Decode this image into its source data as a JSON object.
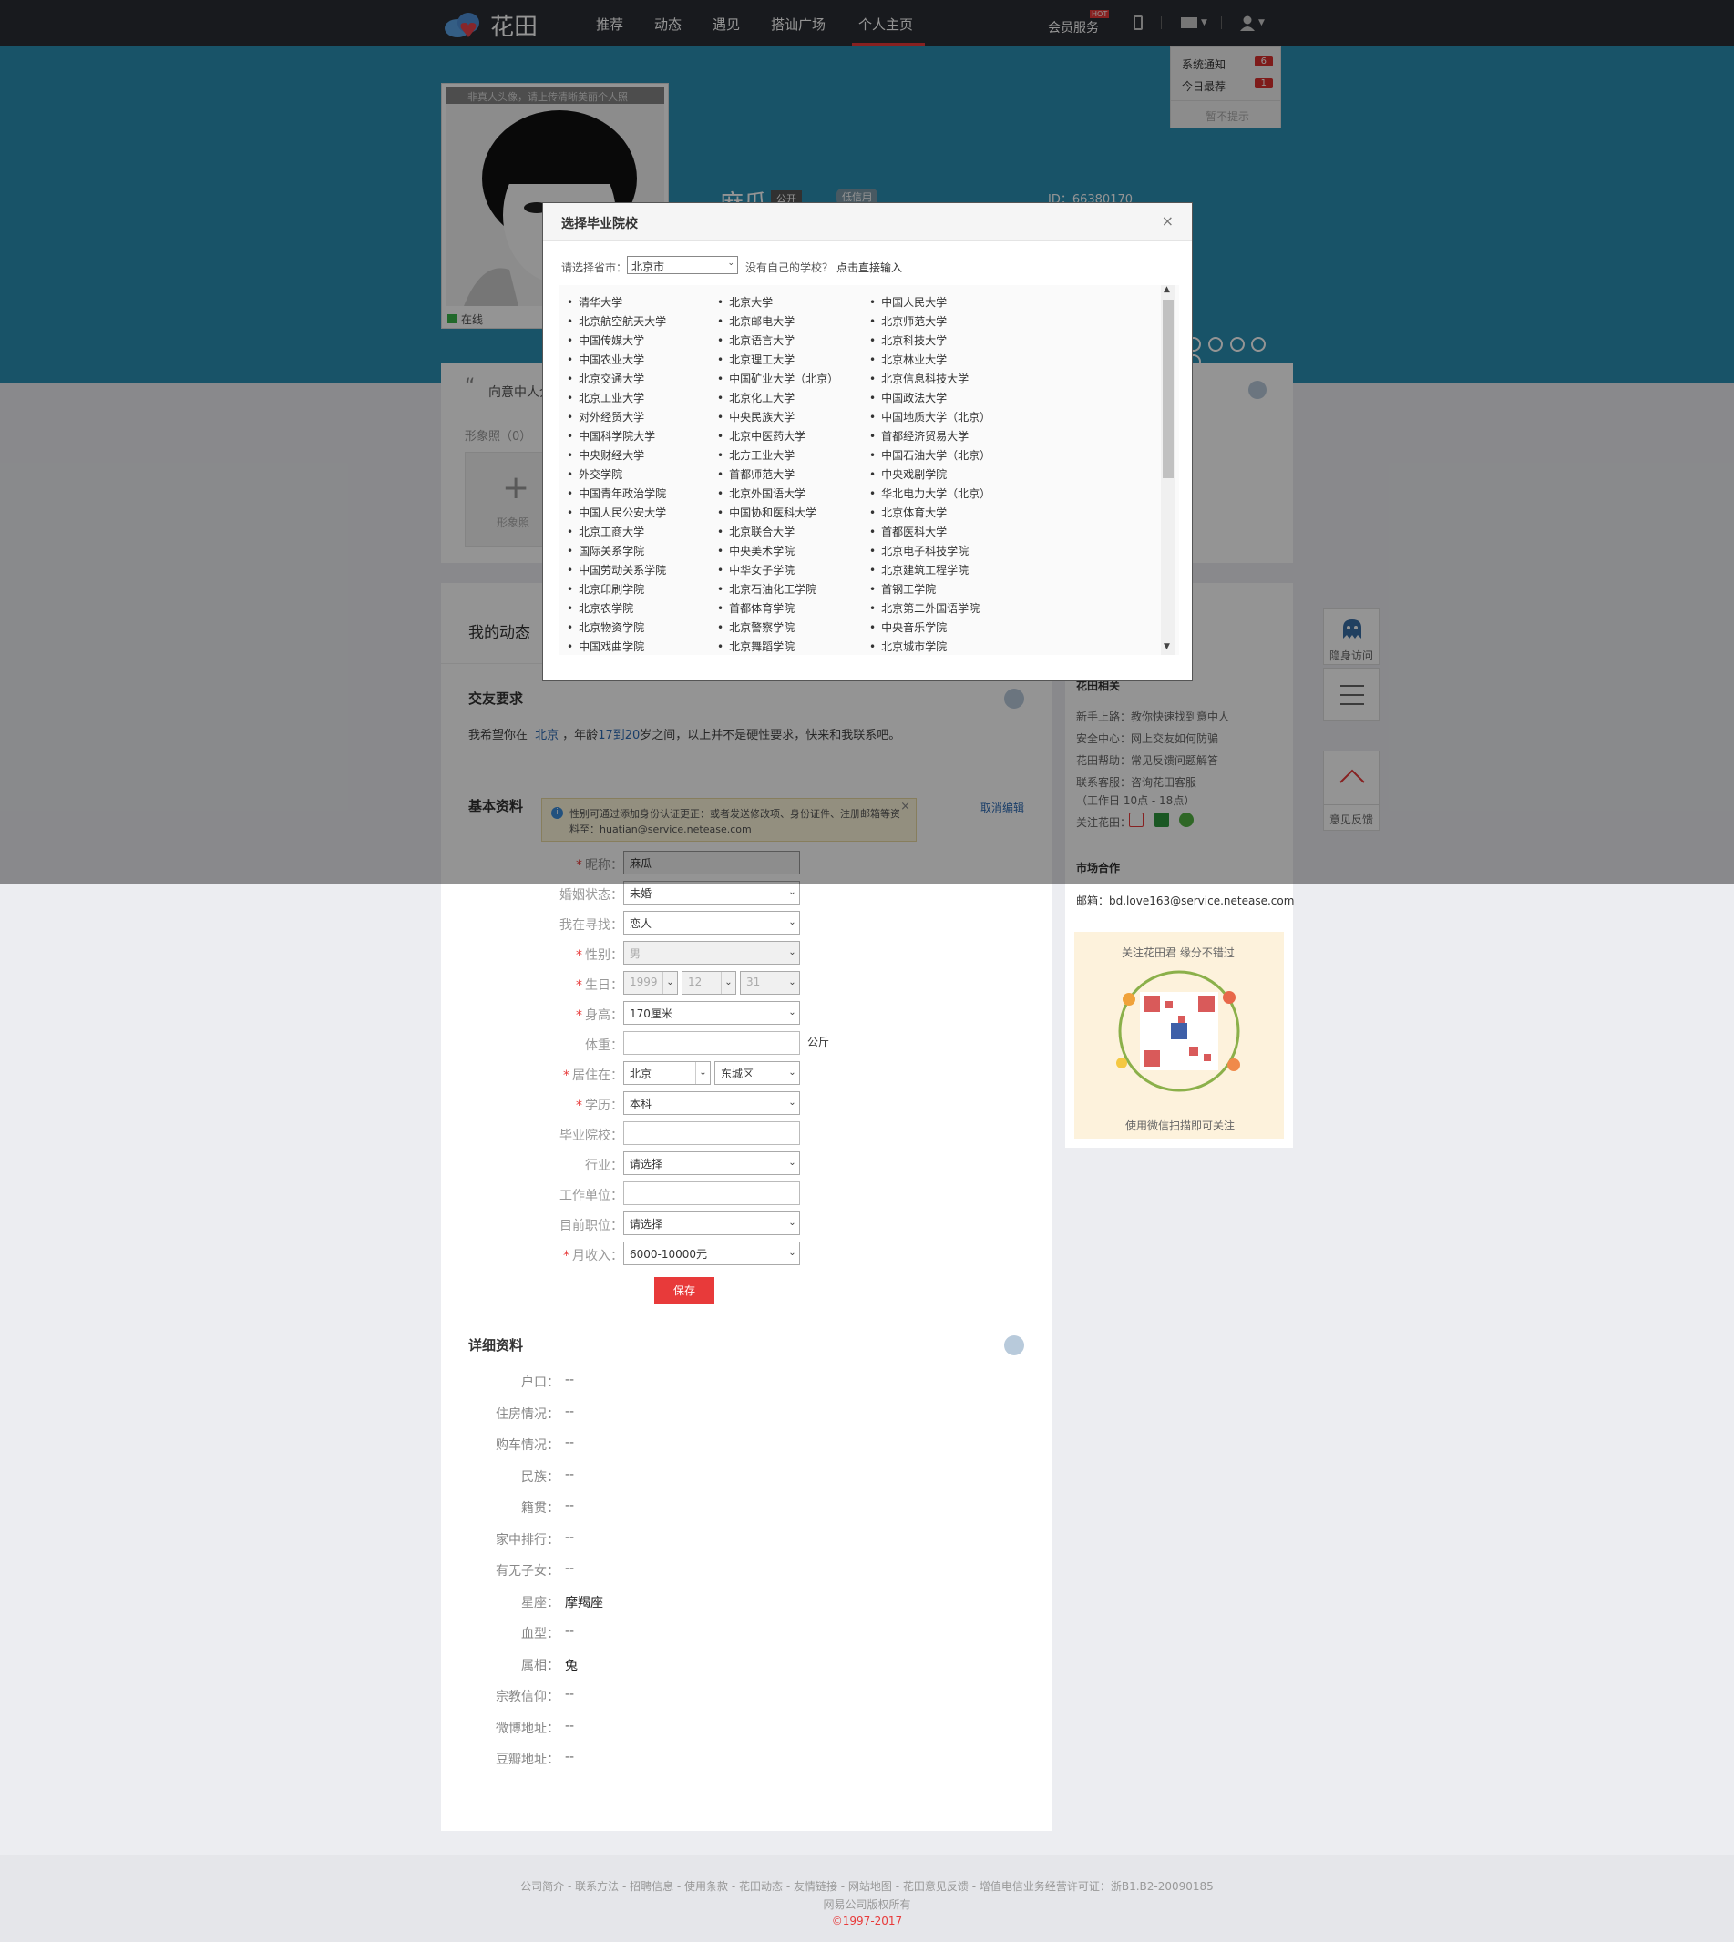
{
  "brand": {
    "name": "花田"
  },
  "nav": [
    "推荐",
    "动态",
    "遇见",
    "搭讪广场",
    "个人主页"
  ],
  "topright": {
    "vip": "会员服务",
    "hot": "HOT"
  },
  "notice": {
    "items": [
      {
        "label": "系统通知",
        "count": "6"
      },
      {
        "label": "今日最荐",
        "count": "1"
      }
    ],
    "off": "暂不提示"
  },
  "profile": {
    "avatar_tip": "非真人头像，请上传清晰美丽个人照",
    "online": "在线",
    "name": "麻瓜",
    "badge": "公开",
    "credit": "低信用",
    "id": "ID：66380170"
  },
  "intro": {
    "label": "向意中人介绍一下自己吧",
    "photos": "形象照（0）",
    "add": "形象照"
  },
  "sections": {
    "dynamic": "我的动态",
    "friend_req": "交友要求",
    "basic": "基本资料",
    "detail": "详细资料",
    "cancel_edit": "取消编辑"
  },
  "friend_text": {
    "pre": "我希望你在",
    "city": "北京",
    "mid": "，年龄",
    "a1": "17",
    "to": "到",
    "a2": "20",
    "post": "岁之间，以上并不是硬性要求，快来和我联系吧。"
  },
  "tip": "性别可通过添加身份认证更正：或者发送修改项、身份证件、注册邮箱等资料至：huatian@service.netease.com",
  "form": [
    {
      "label": "昵称：",
      "req": true,
      "type": "input",
      "value": "麻瓜"
    },
    {
      "label": "婚姻状态：",
      "req": false,
      "type": "select",
      "value": "未婚"
    },
    {
      "label": "我在寻找：",
      "req": false,
      "type": "select",
      "value": "恋人"
    },
    {
      "label": "性别：",
      "req": true,
      "type": "select-dis",
      "value": "男"
    },
    {
      "label": "生日：",
      "req": true,
      "type": "date",
      "year": "1999",
      "month": "12",
      "day": "31"
    },
    {
      "label": "身高：",
      "req": true,
      "type": "select",
      "value": "170厘米"
    },
    {
      "label": "体重：",
      "req": false,
      "type": "input-unit",
      "value": "",
      "unit": "公斤"
    },
    {
      "label": "居住在：",
      "req": true,
      "type": "city",
      "city": "北京",
      "district": "东城区"
    },
    {
      "label": "学历：",
      "req": true,
      "type": "select",
      "value": "本科"
    },
    {
      "label": "毕业院校：",
      "req": false,
      "type": "input",
      "value": ""
    },
    {
      "label": "行业：",
      "req": false,
      "type": "select",
      "value": "请选择"
    },
    {
      "label": "工作单位：",
      "req": false,
      "type": "input",
      "value": ""
    },
    {
      "label": "目前职位：",
      "req": false,
      "type": "select",
      "value": "请选择"
    },
    {
      "label": "月收入：",
      "req": true,
      "type": "select",
      "value": "6000-10000元"
    }
  ],
  "save": "保存",
  "details": [
    {
      "label": "户口：",
      "value": "--"
    },
    {
      "label": "住房情况：",
      "value": "--"
    },
    {
      "label": "购车情况：",
      "value": "--"
    },
    {
      "label": "民族：",
      "value": "--"
    },
    {
      "label": "籍贯：",
      "value": "--"
    },
    {
      "label": "家中排行：",
      "value": "--"
    },
    {
      "label": "有无子女：",
      "value": "--"
    },
    {
      "label": "星座：",
      "value": "摩羯座"
    },
    {
      "label": "血型：",
      "value": "--"
    },
    {
      "label": "属相：",
      "value": "兔"
    },
    {
      "label": "宗教信仰：",
      "value": "--"
    },
    {
      "label": "微博地址：",
      "value": "--"
    },
    {
      "label": "豆瓣地址：",
      "value": "--"
    }
  ],
  "side": {
    "title": "花田相关",
    "links": [
      "新手上路：教你快速找到意中人",
      "安全中心：网上交友如何防骗",
      "花田帮助：常见反馈问题解答",
      "联系客服：咨询花田客服",
      "（工作日 10点 - 18点）",
      "关注花田："
    ],
    "market": "市场合作",
    "email": "邮箱：bd.love163@service.netease.com",
    "qr_top": "关注花田君 缘分不错过",
    "qr_bottom": "使用微信扫描即可关注"
  },
  "float": {
    "visit": "隐身访问",
    "feedback": "意见反馈"
  },
  "modal": {
    "title": "选择毕业院校",
    "province_label": "请选择省市：",
    "province": "北京市",
    "no_school": "没有自己的学校？",
    "direct": "点击直接输入",
    "schools": [
      [
        "清华大学",
        "北京大学",
        "中国人民大学"
      ],
      [
        "北京航空航天大学",
        "北京邮电大学",
        "北京师范大学"
      ],
      [
        "中国传媒大学",
        "北京语言大学",
        "北京科技大学"
      ],
      [
        "中国农业大学",
        "北京理工大学",
        "北京林业大学"
      ],
      [
        "北京交通大学",
        "中国矿业大学（北京）",
        "北京信息科技大学"
      ],
      [
        "北京工业大学",
        "北京化工大学",
        "中国政法大学"
      ],
      [
        "对外经贸大学",
        "中央民族大学",
        "中国地质大学（北京）"
      ],
      [
        "中国科学院大学",
        "北京中医药大学",
        "首都经济贸易大学"
      ],
      [
        "中央财经大学",
        "北方工业大学",
        "中国石油大学（北京）"
      ],
      [
        "外交学院",
        "首都师范大学",
        "中央戏剧学院"
      ],
      [
        "中国青年政治学院",
        "北京外国语大学",
        "华北电力大学（北京）"
      ],
      [
        "中国人民公安大学",
        "中国协和医科大学",
        "北京体育大学"
      ],
      [
        "北京工商大学",
        "北京联合大学",
        "首都医科大学"
      ],
      [
        "国际关系学院",
        "中央美术学院",
        "北京电子科技学院"
      ],
      [
        "中国劳动关系学院",
        "中华女子学院",
        "北京建筑工程学院"
      ],
      [
        "北京印刷学院",
        "北京石油化工学院",
        "首钢工学院"
      ],
      [
        "北京农学院",
        "首都体育学院",
        "北京第二外国语学院"
      ],
      [
        "北京物资学院",
        "北京警察学院",
        "中央音乐学院"
      ],
      [
        "中国戏曲学院",
        "北京舞蹈学院",
        "北京城市学院"
      ]
    ]
  },
  "footer": {
    "links": "公司简介 - 联系方法 - 招聘信息 - 使用条款 - 花田动态 - 友情链接 - 网站地图 - 花田意见反馈 - 增值电信业务经营许可证：浙B1.B2-20090185",
    "copy": "网易公司版权所有",
    "year": "©1997-2017"
  },
  "colors": {
    "banner": "#2a8fb3",
    "topbar": "#2a2d34",
    "accent": "#e83a3a",
    "link": "#2d6bb5"
  }
}
